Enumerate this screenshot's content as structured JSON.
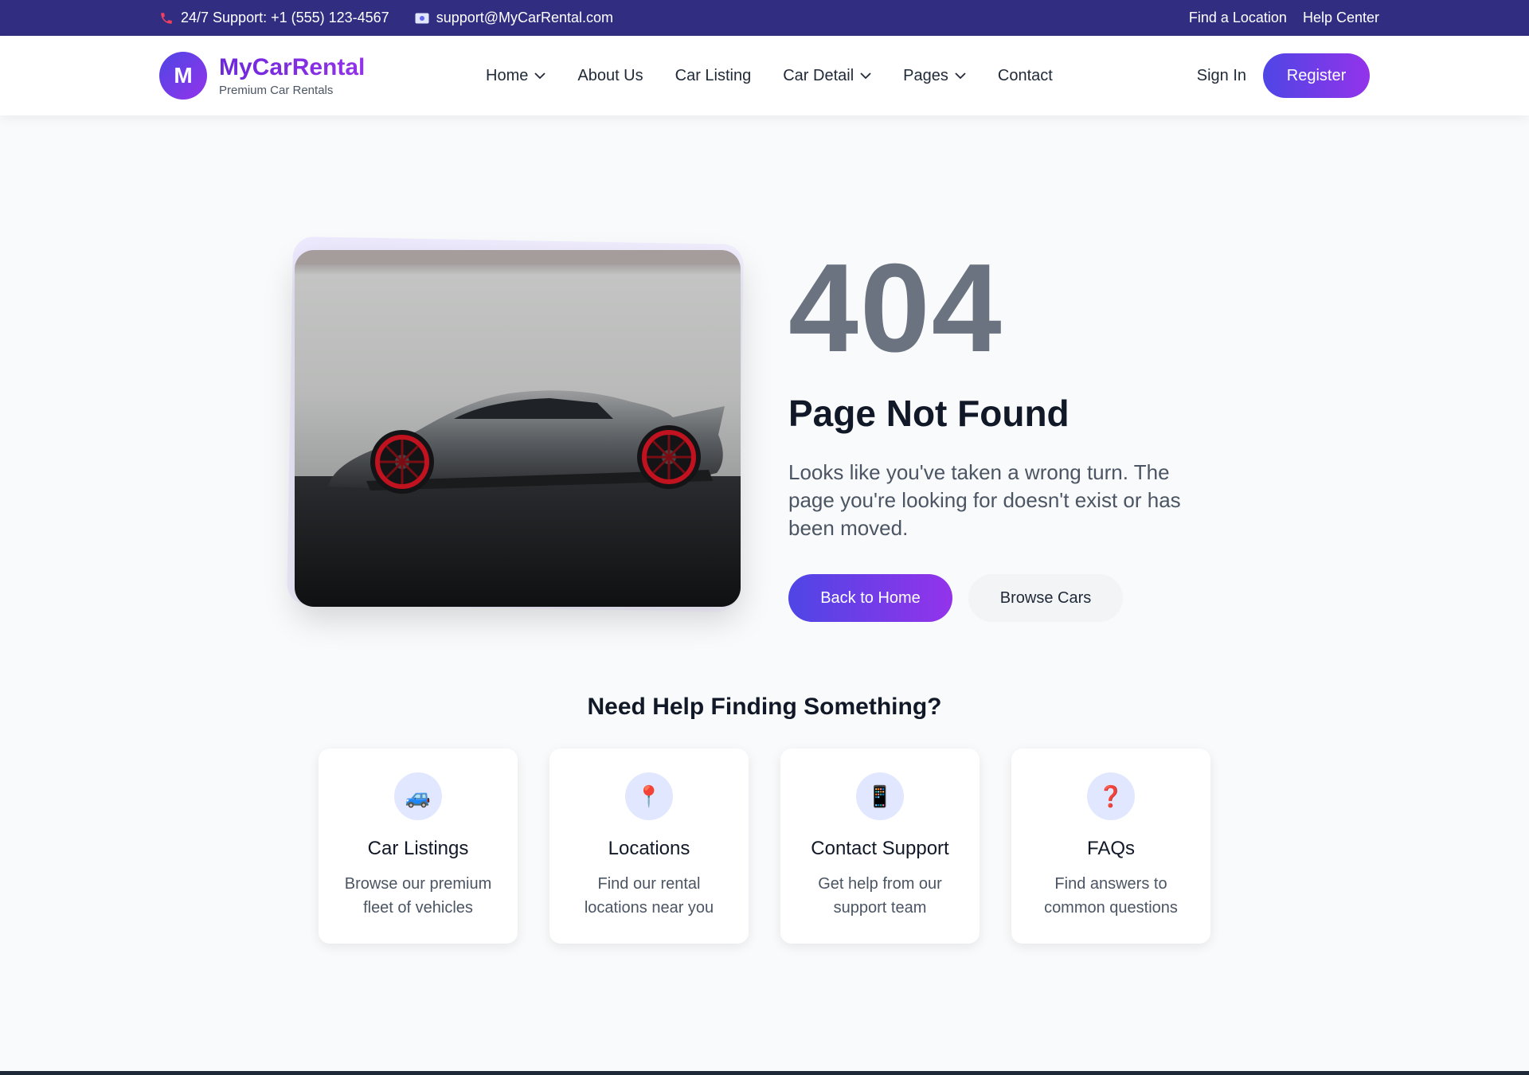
{
  "topbar": {
    "support": "24/7 Support: +1 (555) 123-4567",
    "email": "support@MyCarRental.com",
    "links": [
      "Find a Location",
      "Help Center"
    ]
  },
  "header": {
    "logo_letter": "M",
    "brand": "MyCarRental",
    "tagline": "Premium Car Rentals",
    "nav": [
      "Home",
      "About Us",
      "Car Listing",
      "Car Detail",
      "Pages",
      "Contact"
    ],
    "sign_in": "Sign In",
    "register": "Register"
  },
  "hero": {
    "code": "404",
    "title": "Page Not Found",
    "description": "Looks like you've taken a wrong turn. The page you're looking for doesn't exist or has been moved.",
    "primary_button": "Back to Home",
    "secondary_button": "Browse Cars"
  },
  "help": {
    "title": "Need Help Finding Something?",
    "cards": [
      {
        "icon": "🚙",
        "title": "Car Listings",
        "description": "Browse our premium fleet of vehicles"
      },
      {
        "icon": "📍",
        "title": "Locations",
        "description": "Find our rental locations near you"
      },
      {
        "icon": "📱",
        "title": "Contact Support",
        "description": "Get help from our support team"
      },
      {
        "icon": "❓",
        "title": "FAQs",
        "description": "Find answers to common questions"
      }
    ]
  },
  "colors": {
    "topbar": "#312e81",
    "accent_start": "#4f46e5",
    "accent_end": "#9333ea",
    "code_text": "#6b7280"
  }
}
